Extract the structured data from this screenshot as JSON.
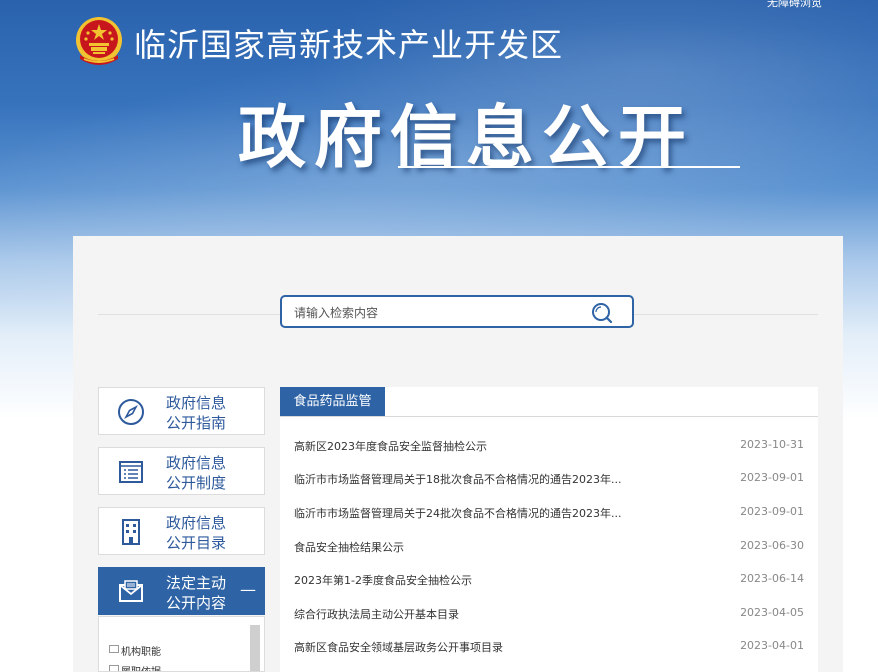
{
  "header": {
    "top_link": "无障碍浏览",
    "site_name": "临沂国家高新技术产业开发区",
    "page_title": "政府信息公开"
  },
  "search": {
    "placeholder": "请输入检索内容",
    "icon": "search-icon"
  },
  "sidebar": {
    "items": [
      {
        "label_line1": "政府信息",
        "label_line2": "公开指南",
        "icon": "compass-icon"
      },
      {
        "label_line1": "政府信息",
        "label_line2": "公开制度",
        "icon": "document-list-icon"
      },
      {
        "label_line1": "政府信息",
        "label_line2": "公开目录",
        "icon": "building-icon"
      },
      {
        "label_line1": "法定主动",
        "label_line2": "公开内容",
        "icon": "mail-icon",
        "active": true,
        "toggle": "—"
      }
    ],
    "tree": [
      {
        "label": "机构职能"
      },
      {
        "label": "履职依据"
      }
    ]
  },
  "content": {
    "tab_label": "食品药品监管",
    "items": [
      {
        "title": "高新区2023年度食品安全监督抽检公示",
        "date": "2023-10-31"
      },
      {
        "title": "临沂市市场监督管理局关于18批次食品不合格情况的通告2023年...",
        "date": "2023-09-01"
      },
      {
        "title": "临沂市市场监督管理局关于24批次食品不合格情况的通告2023年...",
        "date": "2023-09-01"
      },
      {
        "title": "食品安全抽检结果公示",
        "date": "2023-06-30"
      },
      {
        "title": "2023年第1-2季度食品安全抽检公示",
        "date": "2023-06-14"
      },
      {
        "title": "综合行政执法局主动公开基本目录",
        "date": "2023-04-05"
      },
      {
        "title": "高新区食品安全领域基层政务公开事项目录",
        "date": "2023-04-01"
      }
    ]
  },
  "colors": {
    "brand_blue": "#2e63a6",
    "nav_text": "#2e5a9c",
    "emblem_red": "#c8161d",
    "emblem_gold": "#f2c230"
  }
}
